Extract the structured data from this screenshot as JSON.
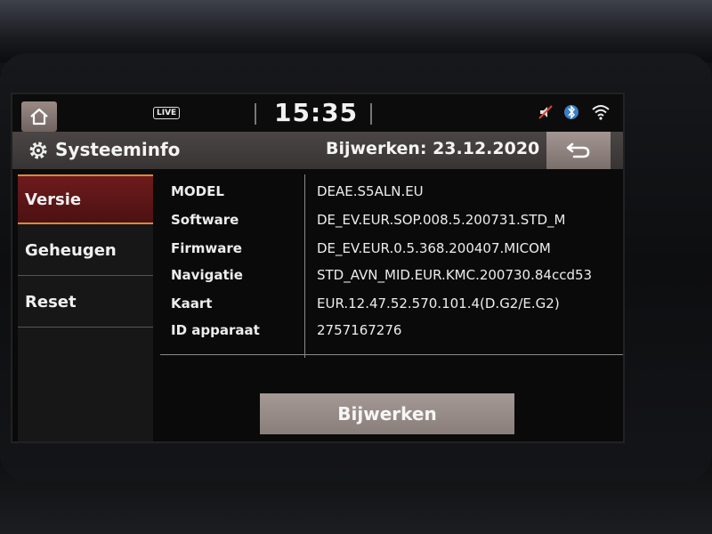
{
  "status": {
    "live_badge": "LIVE",
    "time": "15:35"
  },
  "header": {
    "title": "Systeeminfo",
    "update_info": "Bijwerken: 23.12.2020"
  },
  "sidebar": {
    "items": [
      {
        "label": "Versie",
        "active": true
      },
      {
        "label": "Geheugen",
        "active": false
      },
      {
        "label": "Reset",
        "active": false
      }
    ]
  },
  "info": {
    "rows": [
      {
        "label": "MODEL",
        "value": "DEAE.S5ALN.EU"
      },
      {
        "label": "Software",
        "value": "DE_EV.EUR.SOP.008.5.200731.STD_M"
      },
      {
        "label": "Firmware",
        "value": "DE_EV.EUR.0.5.368.200407.MICOM"
      },
      {
        "label": "Navigatie",
        "value": "STD_AVN_MID.EUR.KMC.200730.84ccd53"
      },
      {
        "label": "Kaart",
        "value": "EUR.12.47.52.570.101.4(D.G2/E.G2)"
      },
      {
        "label": "ID apparaat",
        "value": "2757167276"
      }
    ]
  },
  "actions": {
    "update_button": "Bijwerken"
  },
  "icons": {
    "home": "home-icon",
    "settings": "gear-icon",
    "back": "back-arrow-icon",
    "wifi": "wifi-icon",
    "bluetooth": "bluetooth-icon",
    "mute": "mute-icon"
  },
  "colors": {
    "active_menu": "#6e1b1c",
    "active_border": "#d98a3a",
    "titlebar": "#413c3b",
    "button": "#9a8e8a"
  }
}
